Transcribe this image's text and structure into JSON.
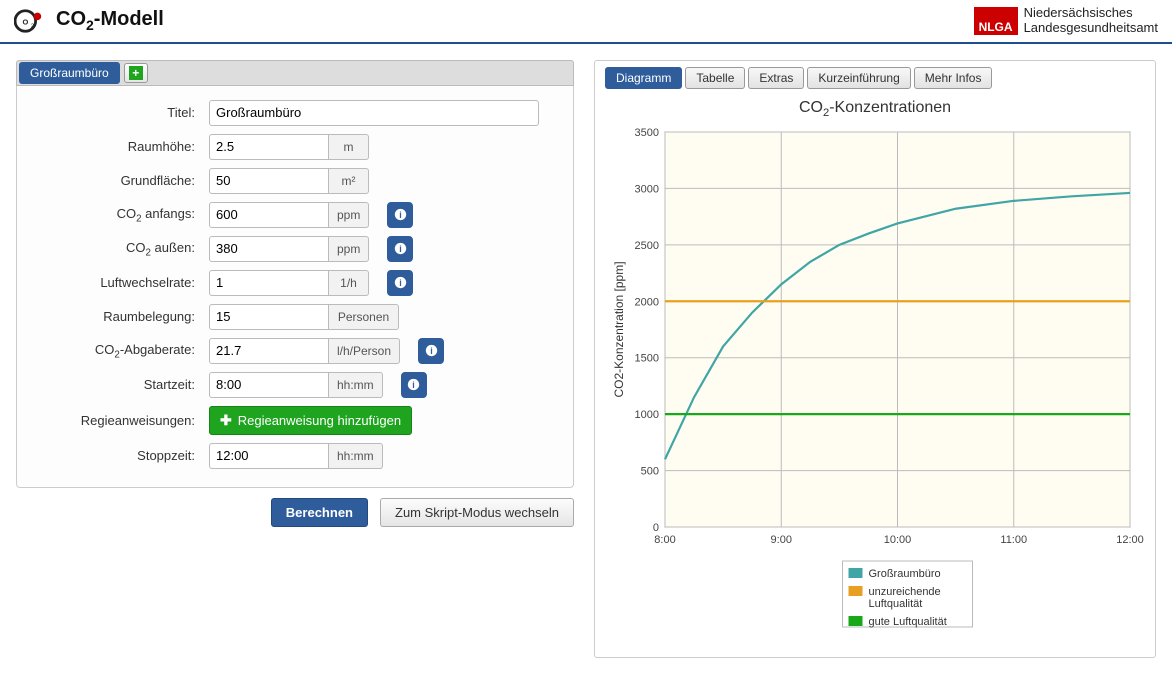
{
  "header": {
    "app_title_html": "CO<sub>2</sub>-Modell",
    "nlga_line1": "Niedersächsisches",
    "nlga_line2": "Landesgesundheitsamt",
    "nlga_abbr": "NLGA"
  },
  "left": {
    "tab_label": "Großraumbüro",
    "fields": {
      "titel_label": "Titel:",
      "titel_value": "Großraumbüro",
      "hoehe_label": "Raumhöhe:",
      "hoehe_value": "2.5",
      "hoehe_unit": "m",
      "flaeche_label": "Grundfläche:",
      "flaeche_value": "50",
      "flaeche_unit": "m²",
      "co2_anf_label_html": "CO<sub>2</sub> anfangs:",
      "co2_anf_value": "600",
      "co2_anf_unit": "ppm",
      "co2_aus_label_html": "CO<sub>2</sub> außen:",
      "co2_aus_value": "380",
      "co2_aus_unit": "ppm",
      "lwr_label": "Luftwechselrate:",
      "lwr_value": "1",
      "lwr_unit": "1/h",
      "beleg_label": "Raumbelegung:",
      "beleg_value": "15",
      "beleg_unit": "Personen",
      "abgabe_label_html": "CO<sub>2</sub>-Abgaberate:",
      "abgabe_value": "21.7",
      "abgabe_unit": "l/h/Person",
      "start_label": "Startzeit:",
      "start_value": "8:00",
      "time_unit": "hh:mm",
      "regie_label": "Regieanweisungen:",
      "regie_btn": "Regieanweisung hinzufügen",
      "stopp_label": "Stoppzeit:",
      "stopp_value": "12:00"
    },
    "actions": {
      "berechnen": "Berechnen",
      "skript": "Zum Skript-Modus wechseln"
    }
  },
  "right": {
    "tabs": [
      "Diagramm",
      "Tabelle",
      "Extras",
      "Kurzeinführung",
      "Mehr Infos"
    ],
    "active_tab": "Diagramm",
    "chart_title_html": "CO<sub>2</sub>-Konzentrationen"
  },
  "chart_data": {
    "type": "line",
    "title": "CO2-Konzentrationen",
    "xlabel": "",
    "ylabel": "CO2-Konzentration [ppm]",
    "x_ticks": [
      "8:00",
      "9:00",
      "10:00",
      "11:00",
      "12:00"
    ],
    "y_ticks": [
      0,
      500,
      1000,
      1500,
      2000,
      2500,
      3000,
      3500
    ],
    "xlim": [
      8,
      12
    ],
    "ylim": [
      0,
      3500
    ],
    "series": [
      {
        "name": "Großraumbüro",
        "color": "#3fa5a5",
        "x": [
          8.0,
          8.25,
          8.5,
          8.75,
          9.0,
          9.25,
          9.5,
          9.75,
          10.0,
          10.5,
          11.0,
          11.5,
          12.0
        ],
        "y": [
          600,
          1150,
          1600,
          1900,
          2150,
          2350,
          2500,
          2600,
          2690,
          2820,
          2890,
          2930,
          2960
        ]
      },
      {
        "name": "unzureichende Luftqualität",
        "color": "#e7a022",
        "x": [
          8.0,
          12.0
        ],
        "y": [
          2000,
          2000
        ]
      },
      {
        "name": "gute Luftqualität",
        "color": "#18a818",
        "x": [
          8.0,
          12.0
        ],
        "y": [
          1000,
          1000
        ]
      }
    ]
  }
}
